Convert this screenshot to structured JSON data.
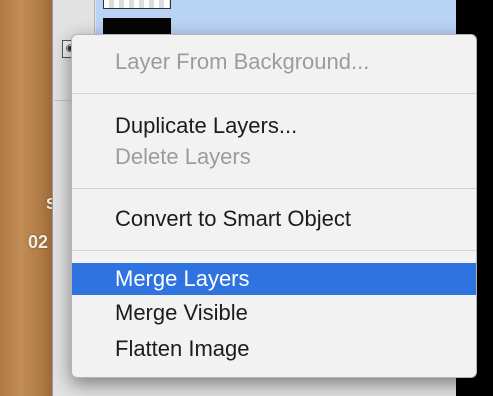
{
  "background": {
    "canvas_fragments": [
      "S",
      "02"
    ]
  },
  "context_menu": {
    "items": [
      {
        "label": "Layer From Background...",
        "enabled": false,
        "highlighted": false
      },
      {
        "label": "Duplicate Layers...",
        "enabled": true,
        "highlighted": false
      },
      {
        "label": "Delete Layers",
        "enabled": false,
        "highlighted": false
      },
      {
        "label": "Convert to Smart Object",
        "enabled": true,
        "highlighted": false
      },
      {
        "label": "Merge Layers",
        "enabled": true,
        "highlighted": true
      },
      {
        "label": "Merge Visible",
        "enabled": true,
        "highlighted": false
      },
      {
        "label": "Flatten Image",
        "enabled": true,
        "highlighted": false
      }
    ]
  },
  "colors": {
    "highlight": "#2f73e0",
    "disabled_text": "#9c9c9c",
    "selected_layer_row": "#b9d3f5",
    "canvas_wood": "#c18c55"
  }
}
